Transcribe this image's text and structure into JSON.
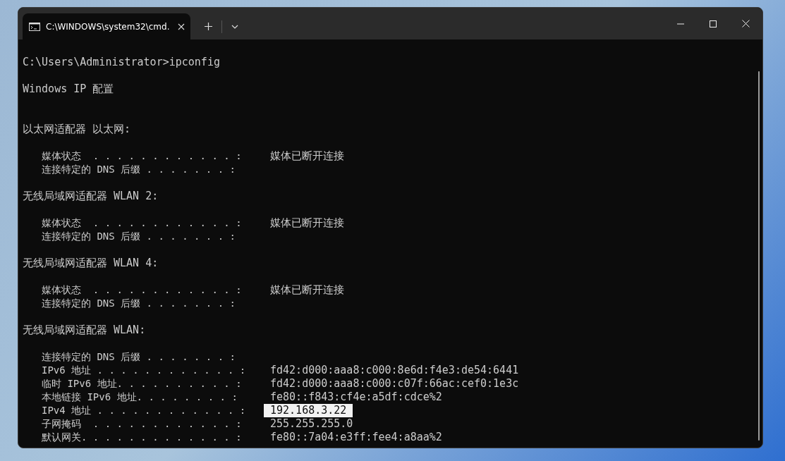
{
  "window": {
    "tab": {
      "title": "C:\\WINDOWS\\system32\\cmd.",
      "selected": true
    }
  },
  "terminal": {
    "lines": [
      {
        "kind": "text",
        "text": "C:\\Users\\Administrator>ipconfig"
      },
      {
        "kind": "blank"
      },
      {
        "kind": "text",
        "text": "Windows IP 配置"
      },
      {
        "kind": "blank"
      },
      {
        "kind": "blank"
      },
      {
        "kind": "text",
        "text": "以太网适配器 以太网:"
      },
      {
        "kind": "blank"
      },
      {
        "kind": "entry",
        "label": "媒体状态  . . . . . . . . . . . . :",
        "value": "媒体已断开连接"
      },
      {
        "kind": "entry",
        "label": "连接特定的 DNS 后缀 . . . . . . . :"
      },
      {
        "kind": "blank"
      },
      {
        "kind": "text",
        "text": "无线局域网适配器 WLAN 2:"
      },
      {
        "kind": "blank"
      },
      {
        "kind": "entry",
        "label": "媒体状态  . . . . . . . . . . . . :",
        "value": "媒体已断开连接"
      },
      {
        "kind": "entry",
        "label": "连接特定的 DNS 后缀 . . . . . . . :"
      },
      {
        "kind": "blank"
      },
      {
        "kind": "text",
        "text": "无线局域网适配器 WLAN 4:"
      },
      {
        "kind": "blank"
      },
      {
        "kind": "entry",
        "label": "媒体状态  . . . . . . . . . . . . :",
        "value": "媒体已断开连接"
      },
      {
        "kind": "entry",
        "label": "连接特定的 DNS 后缀 . . . . . . . :"
      },
      {
        "kind": "blank"
      },
      {
        "kind": "text",
        "text": "无线局域网适配器 WLAN:"
      },
      {
        "kind": "blank"
      },
      {
        "kind": "entry",
        "label": "连接特定的 DNS 后缀 . . . . . . . :"
      },
      {
        "kind": "entry",
        "label": "IPv6 地址 . . . . . . . . . . . . :",
        "value": "fd42:d000:aaa8:c000:8e6d:f4e3:de54:6441"
      },
      {
        "kind": "entry",
        "label": "临时 IPv6 地址. . . . . . . . . . :",
        "value": "fd42:d000:aaa8:c000:c07f:66ac:cef0:1e3c"
      },
      {
        "kind": "entry",
        "label": "本地链接 IPv6 地址. . . . . . . . :",
        "value": "fe80::f843:cf4e:a5df:cdce%2"
      },
      {
        "kind": "entry",
        "label": "IPv4 地址 . . . . . . . . . . . . :",
        "value": "192.168.3.22",
        "highlighted": true
      },
      {
        "kind": "entry",
        "label": "子网掩码  . . . . . . . . . . . . :",
        "value": "255.255.255.0"
      },
      {
        "kind": "entry",
        "label": "默认网关. . . . . . . . . . . . . :",
        "value": "fe80::7a04:e3ff:fee4:a8aa%2"
      }
    ]
  }
}
